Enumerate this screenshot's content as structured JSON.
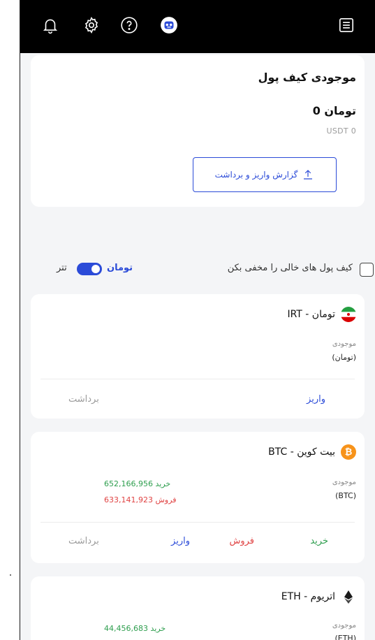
{
  "header": {
    "icons": [
      "bell-icon",
      "gear-icon",
      "help-icon",
      "robot-icon",
      "menu-icon"
    ]
  },
  "wallet": {
    "title": "موجودی کیف پول",
    "balance_toman": "0 تومان",
    "balance_usdt": "USDT 0",
    "report_button": "گزارش واریز و برداشت"
  },
  "filters": {
    "hide_empty_label": "کیف پول های خالی را مخفی بکن",
    "hide_empty_checked": false,
    "toman_label": "تومان",
    "tether_label": "تتر",
    "toggle_on": true
  },
  "assets": [
    {
      "name": "تومان - IRT",
      "icon": "iran-flag-icon",
      "balance_label": "موجودی",
      "unit": "(تومان)",
      "actions": {
        "deposit": "واریز",
        "withdraw": "برداشت"
      }
    },
    {
      "name": "بیت کوین - BTC",
      "icon": "bitcoin-icon",
      "color": "#f7931a",
      "balance_label": "موجودی",
      "unit": "(BTC)",
      "buy_price": "652,166,956",
      "sell_price": "633,141,923",
      "buy_word": "خرید",
      "sell_word": "فروش",
      "actions": {
        "buy": "خرید",
        "sell": "فروش",
        "deposit": "واریز",
        "withdraw": "برداشت"
      }
    },
    {
      "name": "اتریوم - ETH",
      "icon": "ethereum-icon",
      "balance_label": "موجودی",
      "unit": "(ETH)",
      "buy_price": "44,456,683",
      "buy_word": "خرید"
    }
  ],
  "colors": {
    "accent": "#2b4bd8",
    "buy": "#2e9e4e",
    "sell": "#e04444",
    "topbar": "#000000"
  }
}
